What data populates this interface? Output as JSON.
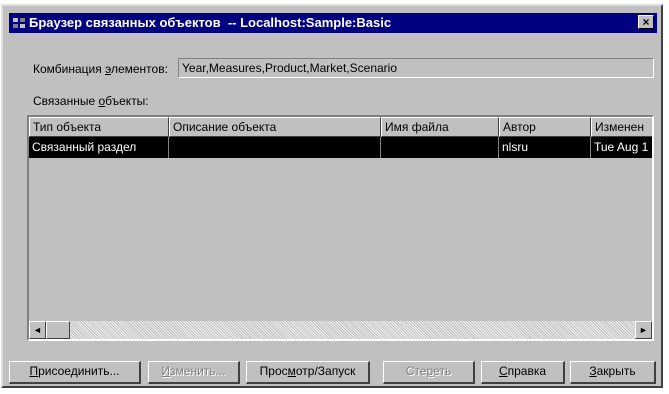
{
  "window": {
    "title": "Браузер связанных объектов  -- Localhost:Sample:Basic",
    "close_glyph": "×"
  },
  "combination": {
    "label_pre": "Комбинация ",
    "label_accel": "э",
    "label_post": "лементов:",
    "value": "Year,Measures,Product,Market,Scenario"
  },
  "linked": {
    "label_pre": "Связанные ",
    "label_accel": "о",
    "label_post": "бъекты:"
  },
  "table": {
    "columns": [
      "Тип объекта",
      "Описание объекта",
      "Имя файла",
      "Автор",
      "Изменен"
    ],
    "rows": [
      [
        "Связанный раздел",
        "",
        "",
        "nlsru",
        "Tue Aug 1"
      ]
    ]
  },
  "scrollbar": {
    "left_glyph": "◄",
    "right_glyph": "►"
  },
  "buttons": {
    "attach": {
      "pre": "",
      "accel": "П",
      "post": "рисоединить..."
    },
    "edit": {
      "pre": "",
      "accel": "И",
      "post": "зменить..."
    },
    "view": {
      "pre": "Прос",
      "accel": "м",
      "post": "отр/Запуск"
    },
    "delete": {
      "pre": "Сте",
      "accel": "р",
      "post": "еть"
    },
    "help": {
      "pre": "",
      "accel": "С",
      "post": "правка"
    },
    "close": {
      "pre": "",
      "accel": "З",
      "post": "акрыть"
    }
  }
}
